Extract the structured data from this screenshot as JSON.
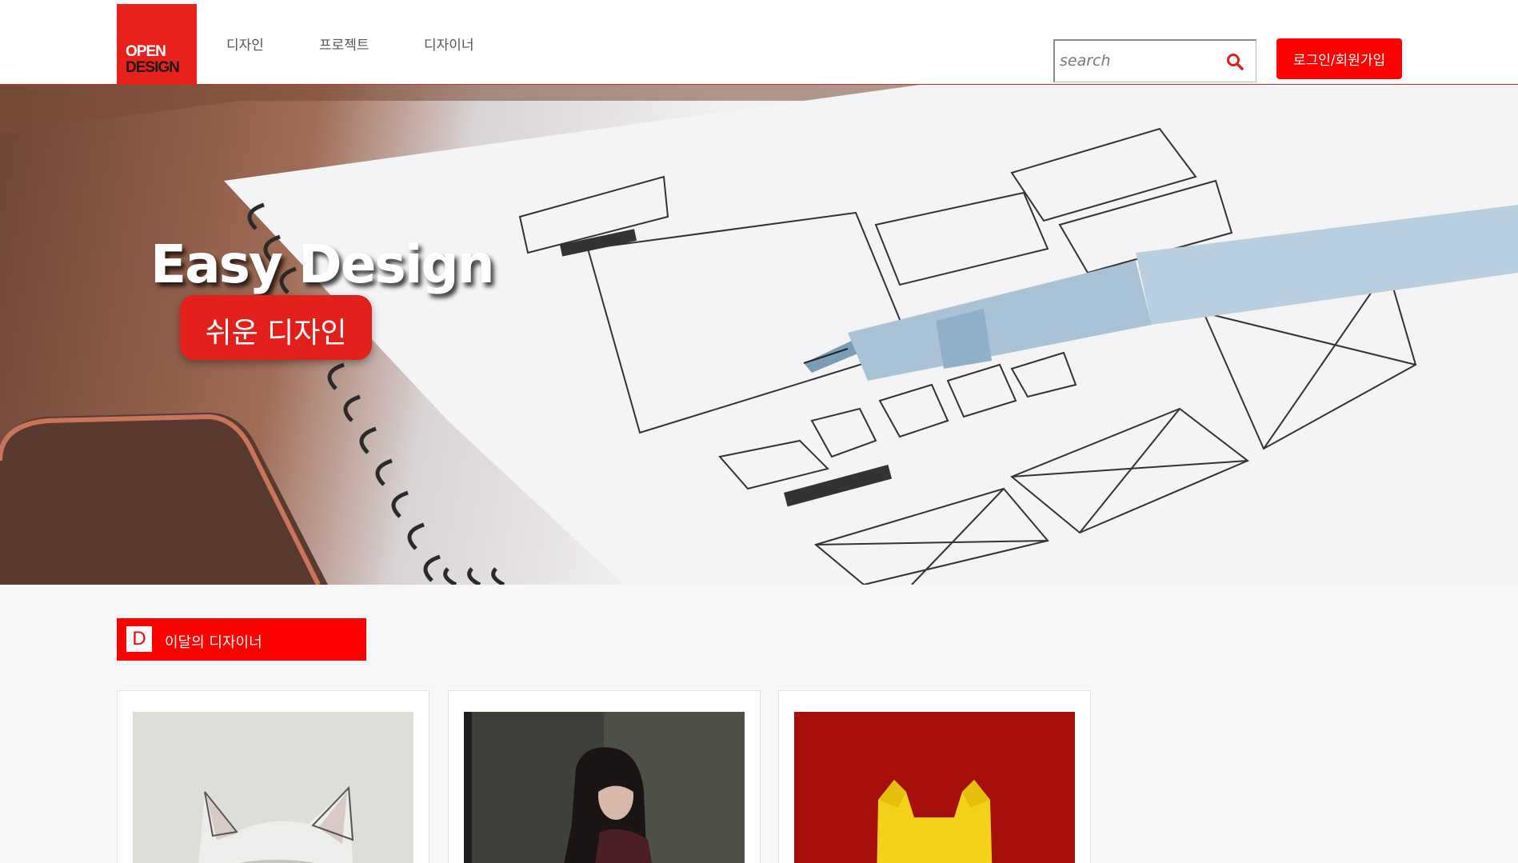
{
  "header": {
    "logo": {
      "line1": "OPEN",
      "line2": "DESIGN"
    },
    "nav": [
      {
        "label": "디자인"
      },
      {
        "label": "프로젝트"
      },
      {
        "label": "디자이너"
      }
    ],
    "search": {
      "placeholder": "search",
      "icon": "search-icon"
    },
    "login_label": "로그인/회원가입"
  },
  "hero": {
    "title": "Easy Design",
    "subtitle": "쉬운 디자인"
  },
  "section": {
    "badge": "D",
    "title": "이달의 디자이너"
  },
  "colors": {
    "accent": "#ff0000",
    "logo_red": "#e8211c",
    "page_bg": "#f7f7f7"
  },
  "designers": [
    {
      "thumb": "white-kitten-photo"
    },
    {
      "thumb": "woman-portrait-photo"
    },
    {
      "thumb": "iron-man-helmet-art"
    }
  ]
}
